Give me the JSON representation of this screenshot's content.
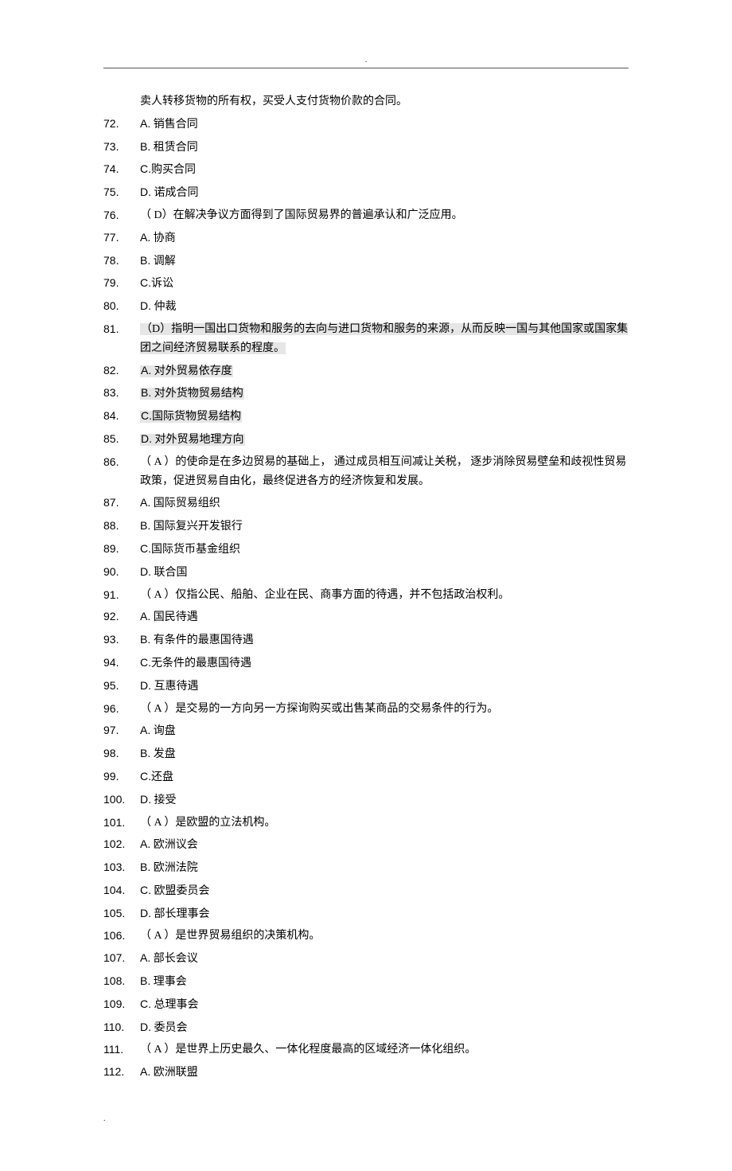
{
  "topDot": ".",
  "bottomDot": ".",
  "lines": [
    {
      "num": "",
      "indent": true,
      "hl": false,
      "text": "卖人转移货物的所有权，买受人支付货物价款的合同。"
    },
    {
      "num": "72.",
      "indent": false,
      "hl": false,
      "letter": "A.",
      "text": " 销售合同"
    },
    {
      "num": "73.",
      "indent": false,
      "hl": false,
      "letter": "B.",
      "text": " 租赁合同"
    },
    {
      "num": "74.",
      "indent": false,
      "hl": false,
      "letter": "C.",
      "text": "购买合同"
    },
    {
      "num": "75.",
      "indent": false,
      "hl": false,
      "letter": "D.",
      "text": " 诺成合同"
    },
    {
      "num": "76.",
      "indent": false,
      "hl": false,
      "text": "（ D）在解决争议方面得到了国际贸易界的普遍承认和广泛应用。"
    },
    {
      "num": "77.",
      "indent": false,
      "hl": false,
      "letter": "A.",
      "text": " 协商"
    },
    {
      "num": "78.",
      "indent": false,
      "hl": false,
      "letter": "B.",
      "text": " 调解"
    },
    {
      "num": "79.",
      "indent": false,
      "hl": false,
      "letter": "C.",
      "text": "诉讼"
    },
    {
      "num": "80.",
      "indent": false,
      "hl": false,
      "letter": "D.",
      "text": " 仲裁"
    },
    {
      "num": "81.",
      "indent": false,
      "hl": true,
      "text": "（D）指明一国出口货物和服务的去向与进口货物和服务的来源，从而反映一国与其他国家或国家集团之间经济贸易联系的程度。"
    },
    {
      "num": "82.",
      "indent": false,
      "hl": true,
      "letter": "A.",
      "text": " 对外贸易依存度"
    },
    {
      "num": "83.",
      "indent": false,
      "hl": true,
      "letter": "B.",
      "text": " 对外货物贸易结构"
    },
    {
      "num": "84.",
      "indent": false,
      "hl": true,
      "letter": "C.",
      "text": "国际货物贸易结构"
    },
    {
      "num": "85.",
      "indent": false,
      "hl": true,
      "letter": "D.",
      "text": " 对外贸易地理方向"
    },
    {
      "num": "86.",
      "indent": false,
      "hl": false,
      "text": "（ A ）的使命是在多边贸易的基础上， 通过成员相互间减让关税， 逐步消除贸易壁垒和歧视性贸易 政策，促进贸易自由化，最终促进各方的经济恢复和发展。"
    },
    {
      "num": "87.",
      "indent": false,
      "hl": false,
      "letter": "A.",
      "text": " 国际贸易组织"
    },
    {
      "num": "88.",
      "indent": false,
      "hl": false,
      "letter": "B.",
      "text": " 国际复兴开发银行"
    },
    {
      "num": "89.",
      "indent": false,
      "hl": false,
      "letter": "C.",
      "text": "国际货币基金组织"
    },
    {
      "num": "90.",
      "indent": false,
      "hl": false,
      "letter": "D.",
      "text": " 联合国"
    },
    {
      "num": "91.",
      "indent": false,
      "hl": false,
      "text": "（ A ）仅指公民、船舶、企业在民、商事方面的待遇，并不包括政治权利。"
    },
    {
      "num": "92.",
      "indent": false,
      "hl": false,
      "letter": "A.",
      "text": " 国民待遇"
    },
    {
      "num": "93.",
      "indent": false,
      "hl": false,
      "letter": "B.",
      "text": " 有条件的最惠国待遇"
    },
    {
      "num": "94.",
      "indent": false,
      "hl": false,
      "letter": "C.",
      "text": "无条件的最惠国待遇"
    },
    {
      "num": "95.",
      "indent": false,
      "hl": false,
      "letter": "D.",
      "text": " 互惠待遇"
    },
    {
      "num": "96.",
      "indent": false,
      "hl": false,
      "text": "（ A  ）是交易的一方向另一方探询购买或出售某商品的交易条件的行为。"
    },
    {
      "num": "97.",
      "indent": false,
      "hl": false,
      "letter": "A.",
      "text": " 询盘"
    },
    {
      "num": "98.",
      "indent": false,
      "hl": false,
      "letter": "B.",
      "text": " 发盘"
    },
    {
      "num": "99.",
      "indent": false,
      "hl": false,
      "letter": "C.",
      "text": "还盘"
    },
    {
      "num": "100.",
      "indent": false,
      "hl": false,
      "letter": "D.",
      "text": " 接受"
    },
    {
      "num": "101.",
      "indent": false,
      "hl": false,
      "text": "（ A ）是欧盟的立法机构。"
    },
    {
      "num": "102.",
      "indent": false,
      "hl": false,
      "letter": "A.",
      "text": " 欧洲议会"
    },
    {
      "num": "103.",
      "indent": false,
      "hl": false,
      "letter": "B.",
      "text": " 欧洲法院"
    },
    {
      "num": "104.",
      "indent": false,
      "hl": false,
      "letter": "C.",
      "text": " 欧盟委员会"
    },
    {
      "num": "105.",
      "indent": false,
      "hl": false,
      "letter": "D.",
      "text": " 部长理事会"
    },
    {
      "num": "106.",
      "indent": false,
      "hl": false,
      "text": "（ A ）是世界贸易组织的决策机构。"
    },
    {
      "num": "107.",
      "indent": false,
      "hl": false,
      "letter": "A.",
      "text": " 部长会议"
    },
    {
      "num": "108.",
      "indent": false,
      "hl": false,
      "letter": "B.",
      "text": " 理事会"
    },
    {
      "num": "109.",
      "indent": false,
      "hl": false,
      "letter": "C.",
      "text": " 总理事会"
    },
    {
      "num": "110.",
      "indent": false,
      "hl": false,
      "letter": "D.",
      "text": " 委员会"
    },
    {
      "num": "111.",
      "indent": false,
      "hl": false,
      "text": "（ A ）是世界上历史最久、一体化程度最高的区域经济一体化组织。"
    },
    {
      "num": "112.",
      "indent": false,
      "hl": false,
      "letter": "A.",
      "text": " 欧洲联盟"
    }
  ]
}
